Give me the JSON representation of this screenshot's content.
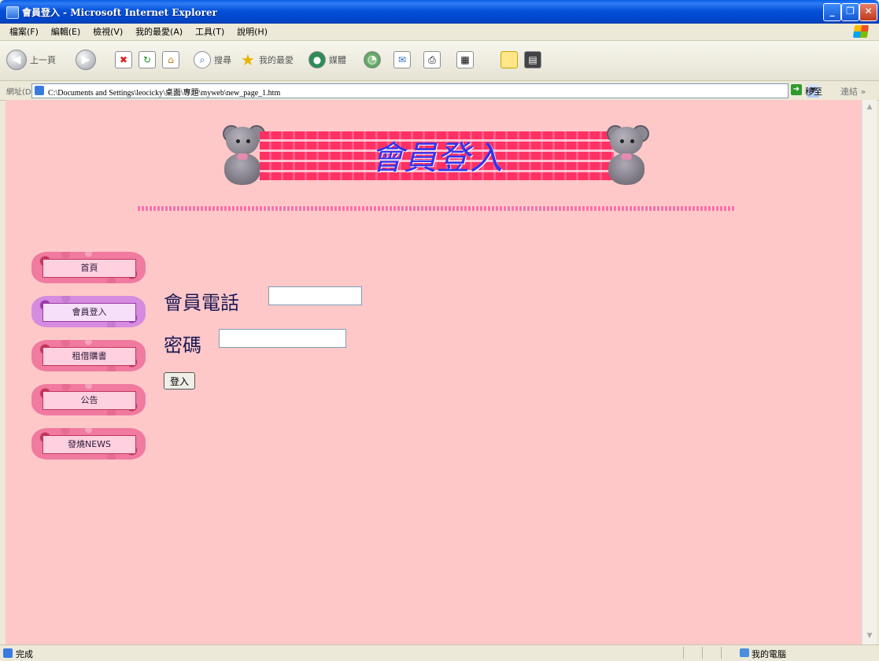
{
  "window": {
    "title": "會員登入 - Microsoft Internet Explorer",
    "min_glyph": "_",
    "max_glyph": "❐",
    "close_glyph": "✕"
  },
  "menubar": {
    "items": [
      "檔案(F)",
      "編輯(E)",
      "檢視(V)",
      "我的最愛(A)",
      "工具(T)",
      "說明(H)"
    ]
  },
  "toolbar": {
    "back_label": "上一頁",
    "search_label": "搜尋",
    "favorites_label": "我的最愛",
    "media_label": "媒體"
  },
  "addressbar": {
    "label": "網址(D)",
    "url": "C:\\Documents and Settings\\leocicky\\桌面\\專題\\myweb\\new_page_1.htm",
    "go_label": "移至",
    "links_label": "連結 »"
  },
  "page": {
    "banner_title": "會員登入",
    "nav": [
      {
        "label": "首頁",
        "active": false
      },
      {
        "label": "會員登入",
        "active": true
      },
      {
        "label": "租借購書",
        "active": false
      },
      {
        "label": "公告",
        "active": false
      },
      {
        "label": "發燒NEWS",
        "active": false
      }
    ],
    "form": {
      "phone_label": "會員電話",
      "phone_value": "",
      "password_label": "密碼",
      "password_value": "",
      "submit_label": "登入"
    }
  },
  "statusbar": {
    "status_text": "完成",
    "zone_text": "我的電腦"
  },
  "colors": {
    "page_background": "#ffc8c8",
    "banner_title": "#3333ee",
    "titlebar": "#0450d8"
  }
}
